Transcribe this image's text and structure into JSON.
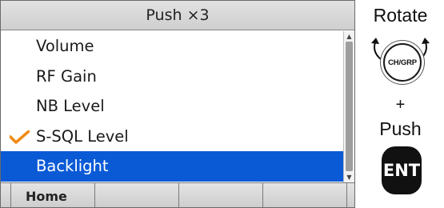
{
  "screen": {
    "title": "Push ×3",
    "menu_items": [
      {
        "label": "Volume",
        "checked": false,
        "selected": false
      },
      {
        "label": "RF Gain",
        "checked": false,
        "selected": false
      },
      {
        "label": "NB Level",
        "checked": false,
        "selected": false
      },
      {
        "label": "S-SQL Level",
        "checked": true,
        "selected": false
      },
      {
        "label": "Backlight",
        "checked": false,
        "selected": true
      }
    ],
    "softkeys": [
      "Home",
      "",
      "",
      ""
    ],
    "selection_color": "#0a5ad6",
    "check_color": "#f08a12"
  },
  "instructions": {
    "rotate": "Rotate",
    "knob_label": "CH/GRP",
    "plus": "+",
    "push": "Push",
    "enter_key": "ENT"
  }
}
